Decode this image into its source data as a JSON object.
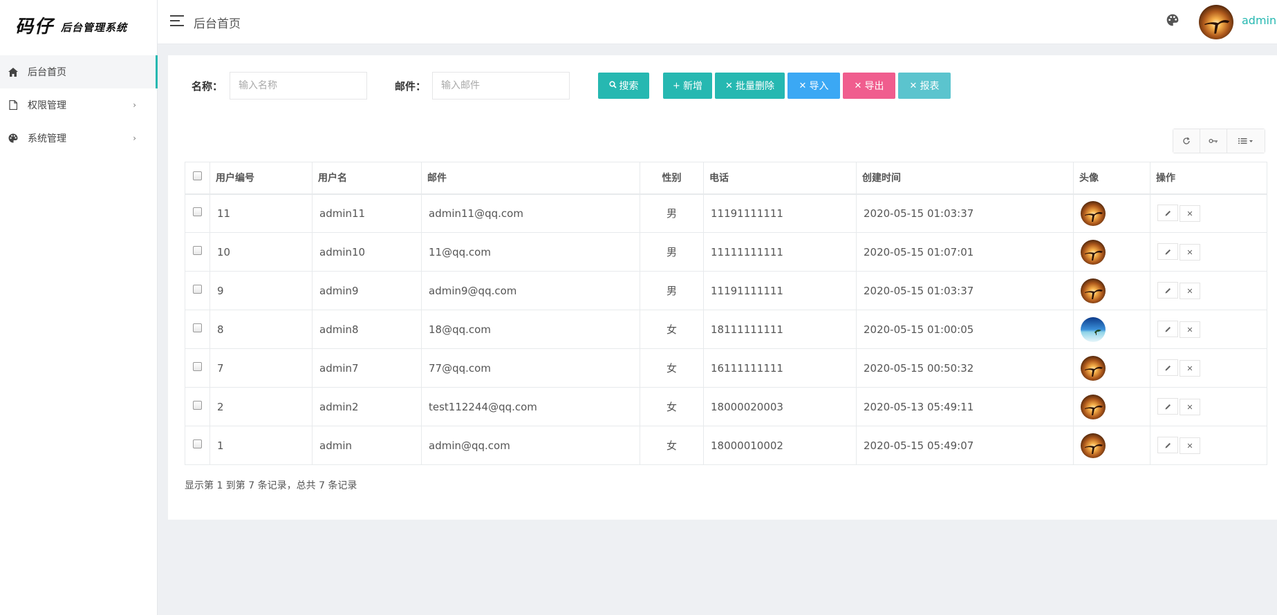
{
  "logo": {
    "main": "码仔",
    "sub": "后台管理系统"
  },
  "sidebar": {
    "items": [
      {
        "label": "后台首页",
        "icon": "home-icon",
        "active": true
      },
      {
        "label": "权限管理",
        "icon": "file-icon",
        "arrow": "›"
      },
      {
        "label": "系统管理",
        "icon": "palette-icon",
        "arrow": "›"
      }
    ]
  },
  "header": {
    "title": "后台首页",
    "user": "admin"
  },
  "search": {
    "name_label": "名称：",
    "name_placeholder": "输入名称",
    "email_label": "邮件：",
    "email_placeholder": "输入邮件"
  },
  "buttons": {
    "search": "搜索",
    "add": "新增",
    "batch_delete": "批量删除",
    "import": "导入",
    "export": "导出",
    "report": "报表"
  },
  "colors": {
    "teal": "#26b8b1",
    "blue": "#3ba8f4",
    "pink": "#f05d8e",
    "cyan": "#5bc4ce"
  },
  "table": {
    "headers": [
      "用户编号",
      "用户名",
      "邮件",
      "性别",
      "电话",
      "创建时间",
      "头像",
      "操作"
    ],
    "rows": [
      {
        "id": "11",
        "username": "admin11",
        "email": "admin11@qq.com",
        "gender": "男",
        "phone": "11191111111",
        "created": "2020-05-15 01:03:37",
        "avatar": "sunset"
      },
      {
        "id": "10",
        "username": "admin10",
        "email": "11@qq.com",
        "gender": "男",
        "phone": "11111111111",
        "created": "2020-05-15 01:07:01",
        "avatar": "sunset"
      },
      {
        "id": "9",
        "username": "admin9",
        "email": "admin9@qq.com",
        "gender": "男",
        "phone": "11191111111",
        "created": "2020-05-15 01:03:37",
        "avatar": "sunset"
      },
      {
        "id": "8",
        "username": "admin8",
        "email": "18@qq.com",
        "gender": "女",
        "phone": "18111111111",
        "created": "2020-05-15 01:00:05",
        "avatar": "sea"
      },
      {
        "id": "7",
        "username": "admin7",
        "email": "77@qq.com",
        "gender": "女",
        "phone": "16111111111",
        "created": "2020-05-15 00:50:32",
        "avatar": "sunset"
      },
      {
        "id": "2",
        "username": "admin2",
        "email": "test112244@qq.com",
        "gender": "女",
        "phone": "18000020003",
        "created": "2020-05-13 05:49:11",
        "avatar": "sunset"
      },
      {
        "id": "1",
        "username": "admin",
        "email": "admin@qq.com",
        "gender": "女",
        "phone": "18000010002",
        "created": "2020-05-15 05:49:07",
        "avatar": "sunset"
      }
    ]
  },
  "pagination": {
    "info": "显示第 1 到第 7 条记录，总共 7 条记录"
  }
}
